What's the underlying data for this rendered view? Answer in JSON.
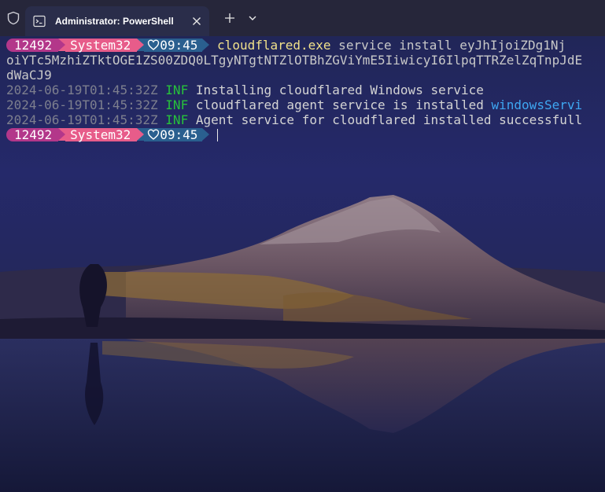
{
  "window": {
    "tab_title": "Administrator: PowerShell",
    "icons": {
      "shield": "shield-icon",
      "tab": "terminal-icon",
      "close": "close-icon",
      "new_tab": "plus-icon",
      "dropdown": "chevron-down-icon"
    }
  },
  "prompt": {
    "pid": "12492",
    "path": "System32",
    "time": "09:45",
    "time_icon": "heart-icon",
    "colors": {
      "pid": "#b3378a",
      "path": "#e75c8a",
      "time": "#2a5f8f"
    }
  },
  "command": {
    "exe": "cloudflared.exe",
    "args_line1": " service install eyJhIjoiZDg1Nj",
    "args_line2": "oiYTc5MzhiZTktOGE1ZS00ZDQ0LTgyNTgtNTZlOTBhZGViYmE5IiwicyI6IlpqTTRZelZqTnpJdE",
    "args_line3": "dWaCJ9"
  },
  "log": [
    {
      "timestamp": "2024-06-19T01:45:32Z",
      "level": "INF",
      "message": " Installing cloudflared Windows service",
      "link": ""
    },
    {
      "timestamp": "2024-06-19T01:45:32Z",
      "level": "INF",
      "message": " cloudflared agent service is installed ",
      "link": "windowsServi"
    },
    {
      "timestamp": "2024-06-19T01:45:32Z",
      "level": "INF",
      "message": " Agent service for cloudflared installed successfull",
      "link": ""
    }
  ]
}
